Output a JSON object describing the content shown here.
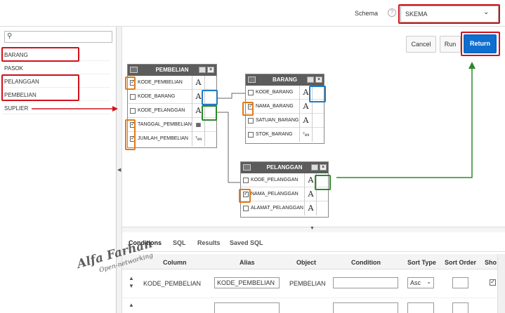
{
  "header": {
    "schema_label": "Schema",
    "help_glyph": "?",
    "schema_value": "SKEMA"
  },
  "left_panel": {
    "search_placeholder": "",
    "tables": [
      "BARANG",
      "PASOK",
      "PELANGGAN",
      "PEMBELIAN",
      "SUPLIER"
    ]
  },
  "actions": {
    "cancel": "Cancel",
    "run": "Run",
    "return": "Return"
  },
  "boxes": {
    "pembelian": {
      "title": "PEMBELIAN",
      "columns": [
        {
          "name": "KODE_PEMBELIAN",
          "checked": true,
          "type_icon": "A"
        },
        {
          "name": "KODE_BARANG",
          "checked": false,
          "type_icon": "A"
        },
        {
          "name": "KODE_PELANGGAN",
          "checked": false,
          "type_icon": "A"
        },
        {
          "name": "TANGGAL_PEMBELIAN",
          "checked": true,
          "type_icon": "calendar-icon"
        },
        {
          "name": "JUMLAH_PEMBELIAN",
          "checked": true,
          "type_icon": "789"
        }
      ]
    },
    "barang": {
      "title": "BARANG",
      "columns": [
        {
          "name": "KODE_BARANG",
          "checked": false,
          "type_icon": "A"
        },
        {
          "name": "NAMA_BARANG",
          "checked": true,
          "type_icon": "A"
        },
        {
          "name": "SATUAN_BARANG",
          "checked": false,
          "type_icon": "A"
        },
        {
          "name": "STOK_BARANG",
          "checked": false,
          "type_icon": "789"
        }
      ]
    },
    "pelanggan": {
      "title": "PELANGGAN",
      "columns": [
        {
          "name": "KODE_PELANGGAN",
          "checked": false,
          "type_icon": "A"
        },
        {
          "name": "NAMA_PELANGGAN",
          "checked": true,
          "type_icon": "A"
        },
        {
          "name": "ALAMAT_PELANGGAN",
          "checked": false,
          "type_icon": "A"
        }
      ]
    }
  },
  "tabs": [
    "Conditions",
    "SQL",
    "Results",
    "Saved SQL"
  ],
  "grid": {
    "headers": [
      "Column",
      "Alias",
      "Object",
      "Condition",
      "Sort Type",
      "Sort Order",
      "Sho"
    ],
    "rows": [
      {
        "column": "KODE_PEMBELIAN",
        "alias": "KODE_PEMBELIAN",
        "object": "PEMBELIAN",
        "condition": "",
        "sort_type": "Asc",
        "sort_order": "",
        "show": true
      }
    ]
  },
  "watermark": {
    "line1": "Alfa Farhan",
    "line2": "Open-networking"
  },
  "colors": {
    "highlight_red": "#d0121b",
    "highlight_orange": "#e07a19",
    "highlight_blue": "#1f7bc4",
    "highlight_green": "#2a8a2a",
    "return_blue": "#0f6fd0"
  }
}
